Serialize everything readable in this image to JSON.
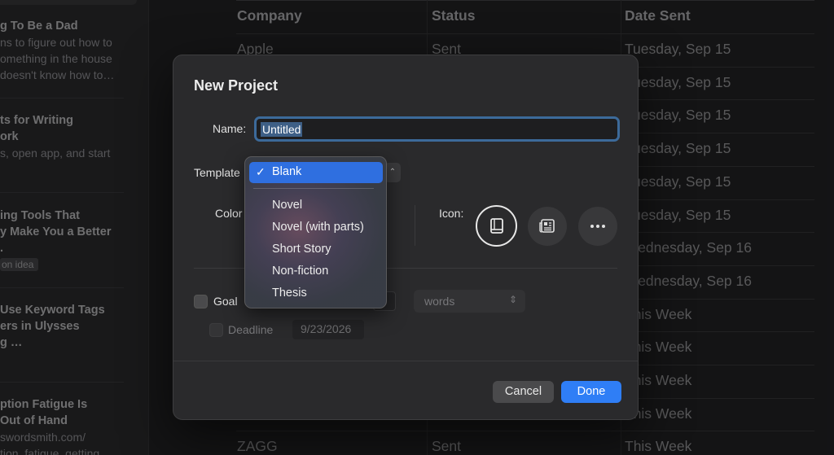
{
  "sidebar": {
    "articles": [
      {
        "title": "g To Be a Dad",
        "snippet": [
          "ns to figure out how to",
          "omething in the house",
          "doesn't know how to…"
        ]
      },
      {
        "title": "ts for Writing\nork",
        "snippet": [
          "s, open app, and start"
        ]
      },
      {
        "title": "ing Tools That\ny Make You a Better\n.",
        "tag": "on idea"
      },
      {
        "title": "Use Keyword Tags\ners in Ulysses\ng …",
        "snippet": [
          ""
        ]
      },
      {
        "title": "ption Fatigue Is\nOut of Hand",
        "snippet": [
          "swordsmith.com/",
          "tion_fatigue_getting"
        ]
      }
    ]
  },
  "table": {
    "headers": {
      "company": "Company",
      "status": "Status",
      "date": "Date Sent"
    },
    "rows": [
      {
        "company": "Apple",
        "status": "Sent",
        "date": "Tuesday, Sep 15"
      },
      {
        "company": "",
        "status": "",
        "date": "Tuesday, Sep 15"
      },
      {
        "company": "",
        "status": "",
        "date": "Tuesday, Sep 15"
      },
      {
        "company": "",
        "status": "",
        "date": "Tuesday, Sep 15"
      },
      {
        "company": "",
        "status": "",
        "date": "Tuesday, Sep 15"
      },
      {
        "company": "",
        "status": "",
        "date": "Tuesday, Sep 15"
      },
      {
        "company": "",
        "status": "",
        "date": "Wednesday, Sep 16"
      },
      {
        "company": "",
        "status": "",
        "date": "Wednesday, Sep 16"
      },
      {
        "company": "",
        "status": "",
        "date": "This Week"
      },
      {
        "company": "",
        "status": "",
        "date": "This Week"
      },
      {
        "company": "",
        "status": "",
        "date": "This Week"
      },
      {
        "company": "",
        "status": "",
        "date": "This Week"
      },
      {
        "company": "ZAGG",
        "status": "Sent",
        "date": "This Week"
      }
    ]
  },
  "dialog": {
    "title": "New Project",
    "name_label": "Name:",
    "name_value": "Untitled",
    "template_label": "Template",
    "color_label": "Color",
    "icon_label": "Icon:",
    "goal_label": "Goal",
    "goal_unit": "words",
    "deadline_label": "Deadline",
    "deadline_value": "9/23/2026",
    "cancel_label": "Cancel",
    "done_label": "Done",
    "icons": [
      "book-icon",
      "newspaper-icon",
      "more-icon"
    ]
  },
  "template_menu": {
    "selected": "Blank",
    "check": "✓",
    "items": [
      "Novel",
      "Novel (with parts)",
      "Short Story",
      "Non-fiction",
      "Thesis"
    ]
  },
  "colors": {
    "accent": "#2f7ef6",
    "menu_highlight": "#2f6fe0",
    "focus_ring": "#3c6a9a"
  }
}
